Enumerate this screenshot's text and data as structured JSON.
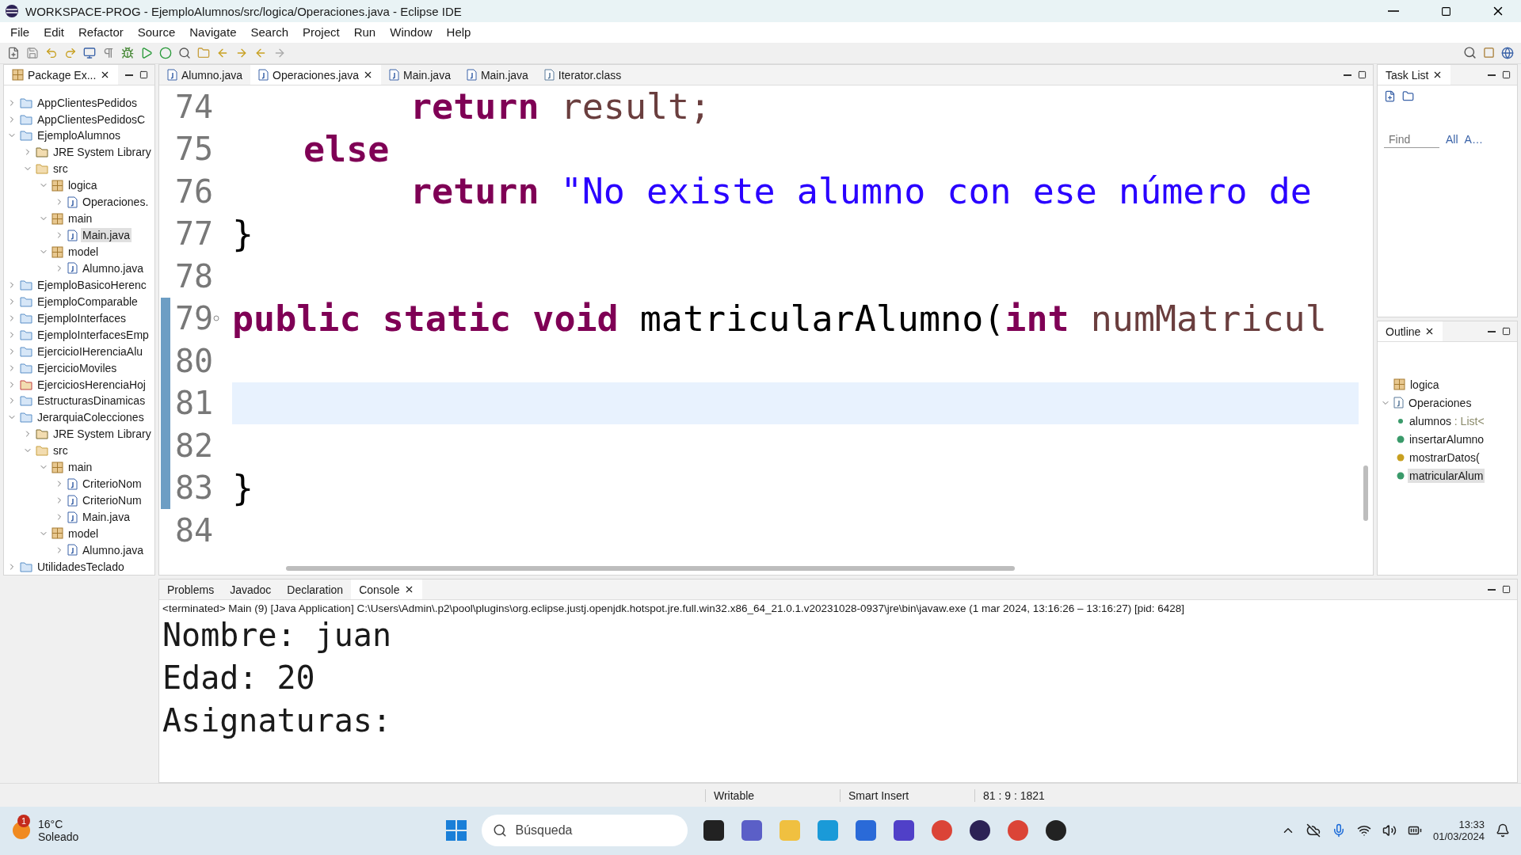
{
  "window": {
    "title": "WORKSPACE-PROG - EjemploAlumnos/src/logica/Operaciones.java - Eclipse IDE"
  },
  "menu": [
    "File",
    "Edit",
    "Refactor",
    "Source",
    "Navigate",
    "Search",
    "Project",
    "Run",
    "Window",
    "Help"
  ],
  "package_explorer": {
    "title": "Package Ex...",
    "tree": [
      {
        "label": "AppClientesPedidos",
        "kind": "project",
        "expanded": false,
        "selected": false
      },
      {
        "label": "AppClientesPedidosC",
        "kind": "project",
        "expanded": false,
        "selected": false
      },
      {
        "label": "EjemploAlumnos",
        "kind": "project",
        "expanded": true,
        "selected": false,
        "children": [
          {
            "label": "JRE System Library",
            "kind": "library",
            "expanded": false,
            "selected": false
          },
          {
            "label": "src",
            "kind": "srcfolder",
            "expanded": true,
            "selected": false,
            "children": [
              {
                "label": "logica",
                "kind": "package",
                "expanded": true,
                "selected": false,
                "children": [
                  {
                    "label": "Operaciones.",
                    "kind": "java",
                    "expanded": false,
                    "selected": false
                  }
                ]
              },
              {
                "label": "main",
                "kind": "package",
                "expanded": true,
                "selected": false,
                "children": [
                  {
                    "label": "Main.java",
                    "kind": "java",
                    "expanded": false,
                    "selected": true
                  }
                ]
              },
              {
                "label": "model",
                "kind": "package",
                "expanded": true,
                "selected": false,
                "children": [
                  {
                    "label": "Alumno.java",
                    "kind": "java",
                    "expanded": false,
                    "selected": false
                  }
                ]
              }
            ]
          }
        ]
      },
      {
        "label": "EjemploBasicoHerenc",
        "kind": "project",
        "expanded": false,
        "selected": false
      },
      {
        "label": "EjemploComparable",
        "kind": "project",
        "expanded": false,
        "selected": false
      },
      {
        "label": "EjemploInterfaces",
        "kind": "project",
        "expanded": false,
        "selected": false
      },
      {
        "label": "EjemploInterfacesEmp",
        "kind": "project",
        "expanded": false,
        "selected": false
      },
      {
        "label": "EjercicioIHerenciaAlu",
        "kind": "project",
        "expanded": false,
        "selected": false
      },
      {
        "label": "EjercicioMoviles",
        "kind": "project",
        "expanded": false,
        "selected": false
      },
      {
        "label": "EjerciciosHerenciaHoj",
        "kind": "errorproject",
        "expanded": false,
        "selected": false
      },
      {
        "label": "EstructurasDinamicas",
        "kind": "project",
        "expanded": false,
        "selected": false
      },
      {
        "label": "JerarquiaColecciones",
        "kind": "project",
        "expanded": true,
        "selected": false,
        "children": [
          {
            "label": "JRE System Library",
            "kind": "library",
            "expanded": false,
            "selected": false
          },
          {
            "label": "src",
            "kind": "srcfolder",
            "expanded": true,
            "selected": false,
            "children": [
              {
                "label": "main",
                "kind": "package",
                "expanded": true,
                "selected": false,
                "children": [
                  {
                    "label": "CriterioNom",
                    "kind": "java",
                    "expanded": false,
                    "selected": false
                  },
                  {
                    "label": "CriterioNum",
                    "kind": "java",
                    "expanded": false,
                    "selected": false
                  },
                  {
                    "label": "Main.java",
                    "kind": "java",
                    "expanded": false,
                    "selected": false
                  }
                ]
              },
              {
                "label": "model",
                "kind": "package",
                "expanded": true,
                "selected": false,
                "children": [
                  {
                    "label": "Alumno.java",
                    "kind": "java",
                    "expanded": false,
                    "selected": false
                  }
                ]
              }
            ]
          }
        ]
      },
      {
        "label": "UtilidadesTeclado",
        "kind": "project",
        "expanded": false,
        "selected": false
      }
    ]
  },
  "editor": {
    "tabs": [
      {
        "label": "Alumno.java",
        "kind": "java",
        "selected": false,
        "closable": false
      },
      {
        "label": "Operaciones.java",
        "kind": "java",
        "selected": true,
        "closable": true
      },
      {
        "label": "Main.java",
        "kind": "java",
        "selected": false,
        "closable": false
      },
      {
        "label": "Main.java",
        "kind": "java",
        "selected": false,
        "closable": false
      },
      {
        "label": "Iterator.class",
        "kind": "class",
        "selected": false,
        "closable": false
      }
    ],
    "lines": [
      {
        "number": "74",
        "kind": "deep",
        "tokens": [
          {
            "text": "return",
            "kind": "keyword"
          },
          {
            "text": " result;",
            "kind": "variable"
          }
        ],
        "current": false,
        "scope": false,
        "fold": false
      },
      {
        "number": "75",
        "kind": "mid",
        "tokens": [
          {
            "text": "else",
            "kind": "keyword"
          }
        ],
        "current": false,
        "scope": false,
        "fold": false
      },
      {
        "number": "76",
        "kind": "deep",
        "tokens": [
          {
            "text": "return",
            "kind": "keyword"
          },
          {
            "text": " \"No existe alumno con ese número de",
            "kind": "string"
          }
        ],
        "current": false,
        "scope": false,
        "fold": false
      },
      {
        "number": "77",
        "tokens": [
          {
            "text": "}",
            "kind": "plain"
          }
        ],
        "current": false,
        "scope": false,
        "fold": false
      },
      {
        "number": "78",
        "current": false,
        "scope": false,
        "fold": false
      },
      {
        "number": "79",
        "tokens": [
          {
            "text": "public static void",
            "kind": "keyword"
          },
          {
            "text": " matricularAlumno(",
            "kind": "plain"
          },
          {
            "text": "int",
            "kind": "keyword"
          },
          {
            "text": " numMatricul",
            "kind": "variable"
          }
        ],
        "current": false,
        "scope": true,
        "fold": true
      },
      {
        "number": "80",
        "current": false,
        "scope": true,
        "fold": false
      },
      {
        "number": "81",
        "current": true,
        "scope": true,
        "fold": false
      },
      {
        "number": "82",
        "current": false,
        "scope": true,
        "fold": false
      },
      {
        "number": "83",
        "tokens": [
          {
            "text": "}",
            "kind": "plain"
          }
        ],
        "current": false,
        "scope": true,
        "fold": false
      },
      {
        "number": "84",
        "current": false,
        "scope": false,
        "fold": false
      }
    ]
  },
  "task_list": {
    "title": "Task List",
    "find_placeholder": "Find",
    "filters": [
      "All",
      "A…"
    ]
  },
  "outline": {
    "title": "Outline",
    "items": [
      {
        "label": "logica",
        "kind": "package",
        "selected": false
      },
      {
        "label": "Operaciones",
        "kind": "class",
        "expanded": true,
        "selected": false,
        "children": [
          {
            "label": "alumnos",
            "type": " : List<",
            "kind": "field",
            "selected": false
          },
          {
            "label": "insertarAlumno",
            "kind": "method",
            "selected": false
          },
          {
            "label": "mostrarDatos(",
            "kind": "warnmethod",
            "selected": false
          },
          {
            "label": "matricularAlum",
            "kind": "method",
            "selected": true
          }
        ]
      }
    ]
  },
  "console": {
    "tabs": [
      {
        "label": "Problems",
        "selected": false,
        "closable": false
      },
      {
        "label": "Javadoc",
        "selected": false,
        "closable": false
      },
      {
        "label": "Declaration",
        "selected": false,
        "closable": false
      },
      {
        "label": "Console",
        "selected": true,
        "closable": true
      }
    ],
    "header": "<terminated> Main (9) [Java Application] C:\\Users\\Admin\\.p2\\pool\\plugins\\org.eclipse.justj.openjdk.hotspot.jre.full.win32.x86_64_21.0.1.v20231028-0937\\jre\\bin\\javaw.exe  (1 mar 2024, 13:16:26 – 13:16:27) [pid: 6428]",
    "output": [
      "Nombre: juan",
      "Edad: 20",
      "Asignaturas:"
    ]
  },
  "status_bar": [
    "Writable",
    "Smart Insert",
    "81 : 9 : 1821"
  ],
  "taskbar": {
    "weather": {
      "badge": "1",
      "temperature": "16°C",
      "condition": "Soleado"
    },
    "search_placeholder": "Búsqueda",
    "time": "13:33",
    "date": "01/03/2024"
  }
}
